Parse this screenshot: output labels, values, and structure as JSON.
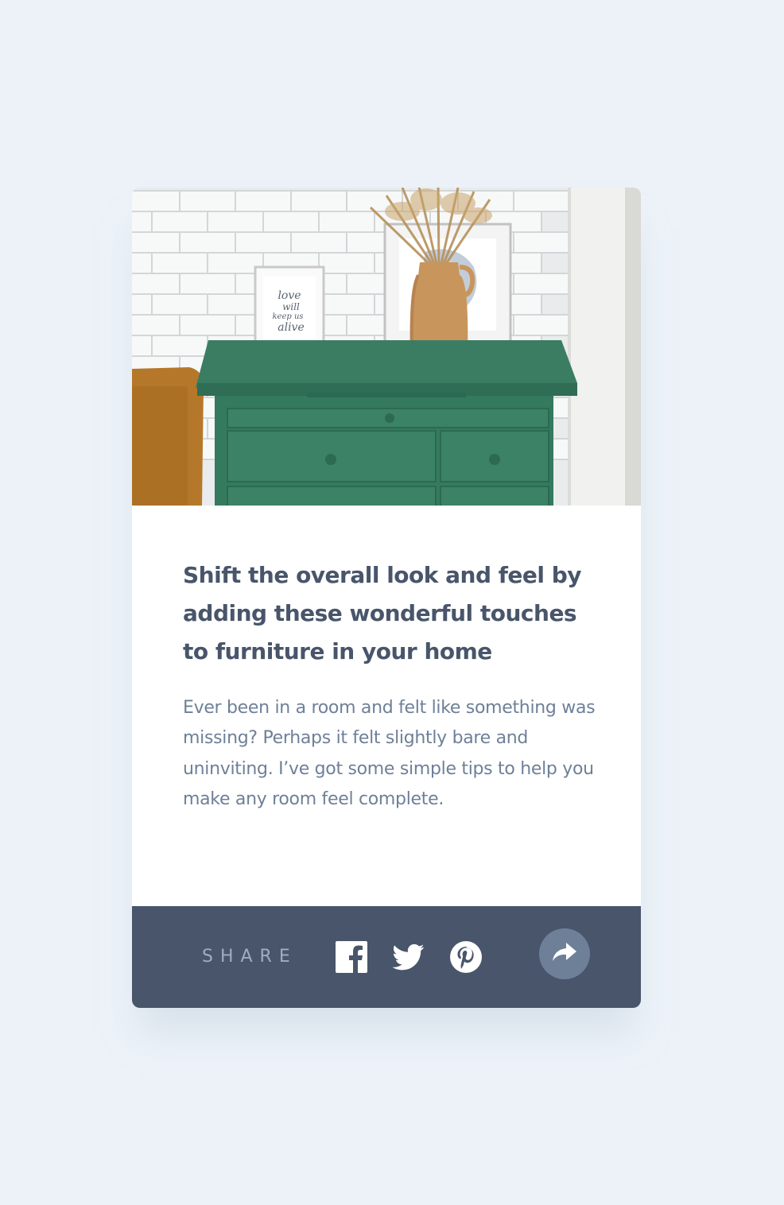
{
  "article": {
    "title": "Shift the overall look and feel by adding these wonderful touches to furniture in your home",
    "description": "Ever been in a room and felt like something was missing? Perhaps it felt slightly bare and uninviting. I’ve got some simple tips to help you make any room feel complete.",
    "image_frame_text": "love will keep us alive"
  },
  "share": {
    "label": "SHARE",
    "icons": [
      "facebook-icon",
      "twitter-icon",
      "pinterest-icon",
      "share-icon"
    ]
  },
  "colors": {
    "page_background": "#ECF2F8",
    "title_text": "#48556A",
    "body_text": "#6E8098",
    "share_bar": "#48556A",
    "share_label": "#9DAEC2",
    "share_button": "#6E8098"
  }
}
